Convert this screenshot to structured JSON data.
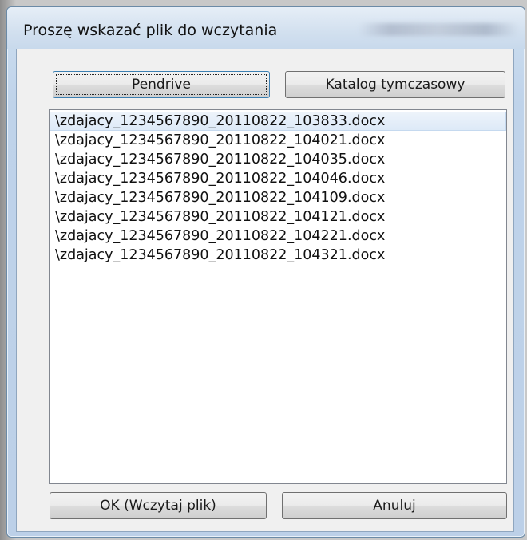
{
  "window": {
    "title": "Proszę wskazać plik do wczytania"
  },
  "buttons": {
    "pendrive": "Pendrive",
    "temp_dir": "Katalog tymczasowy",
    "ok": "OK (Wczytaj plik)",
    "cancel": "Anuluj"
  },
  "file_list": {
    "selected_index": 0,
    "items": [
      "\\zdajacy_1234567890_20110822_103833.docx",
      "\\zdajacy_1234567890_20110822_104021.docx",
      "\\zdajacy_1234567890_20110822_104035.docx",
      "\\zdajacy_1234567890_20110822_104046.docx",
      "\\zdajacy_1234567890_20110822_104109.docx",
      "\\zdajacy_1234567890_20110822_104121.docx",
      "\\zdajacy_1234567890_20110822_104221.docx",
      "\\zdajacy_1234567890_20110822_104321.docx"
    ]
  },
  "colors": {
    "title_bar": "#d2e0ef",
    "client_bg": "#f0f0f0",
    "selection": "#dce9f7"
  }
}
